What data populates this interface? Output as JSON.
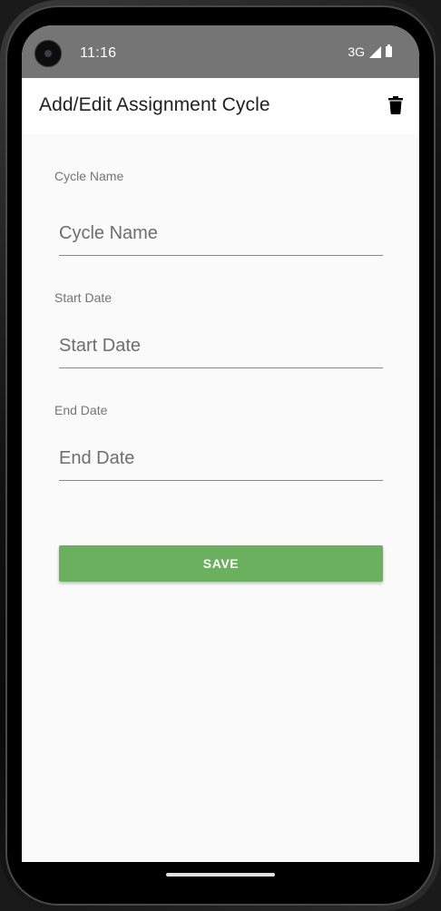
{
  "status_bar": {
    "time": "11:16",
    "network": "3G"
  },
  "app_bar": {
    "title": "Add/Edit Assignment Cycle",
    "delete_icon": "trash-icon"
  },
  "form": {
    "cycle_name": {
      "label": "Cycle Name",
      "value": "",
      "placeholder": "Cycle Name"
    },
    "start_date": {
      "label": "Start Date",
      "value": "",
      "placeholder": "Start Date"
    },
    "end_date": {
      "label": "End Date",
      "value": "",
      "placeholder": "End Date"
    },
    "save_label": "SAVE"
  },
  "colors": {
    "status_bar": "#757575",
    "app_bar": "#ffffff",
    "background": "#fafafa",
    "accent": "#6ab05e"
  }
}
